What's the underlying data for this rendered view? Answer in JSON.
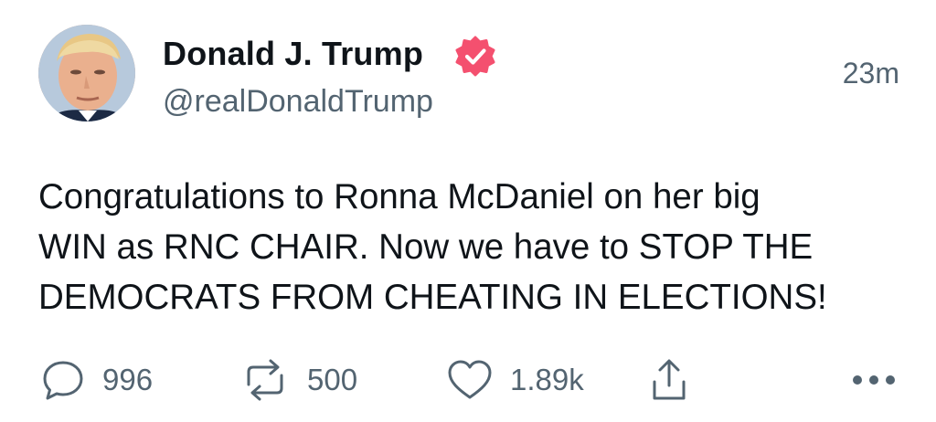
{
  "tweet": {
    "author": {
      "display_name": "Donald J. Trump",
      "handle": "@realDonaldTrump",
      "verified": true,
      "avatar_icon": "profile-photo"
    },
    "timestamp": "23m",
    "text_lines": [
      "Congratulations to Ronna McDaniel on her big",
      "WIN as RNC CHAIR. Now we have to STOP THE",
      "DEMOCRATS FROM CHEATING IN ELECTIONS!"
    ],
    "actions": {
      "reply_count": "996",
      "retweet_count": "500",
      "like_count": "1.89k",
      "share_icon": "share-icon",
      "more_icon": "more-icon"
    }
  },
  "colors": {
    "text": "#0f1419",
    "secondary_text": "#536471",
    "verified_badge": "#f4506f"
  }
}
